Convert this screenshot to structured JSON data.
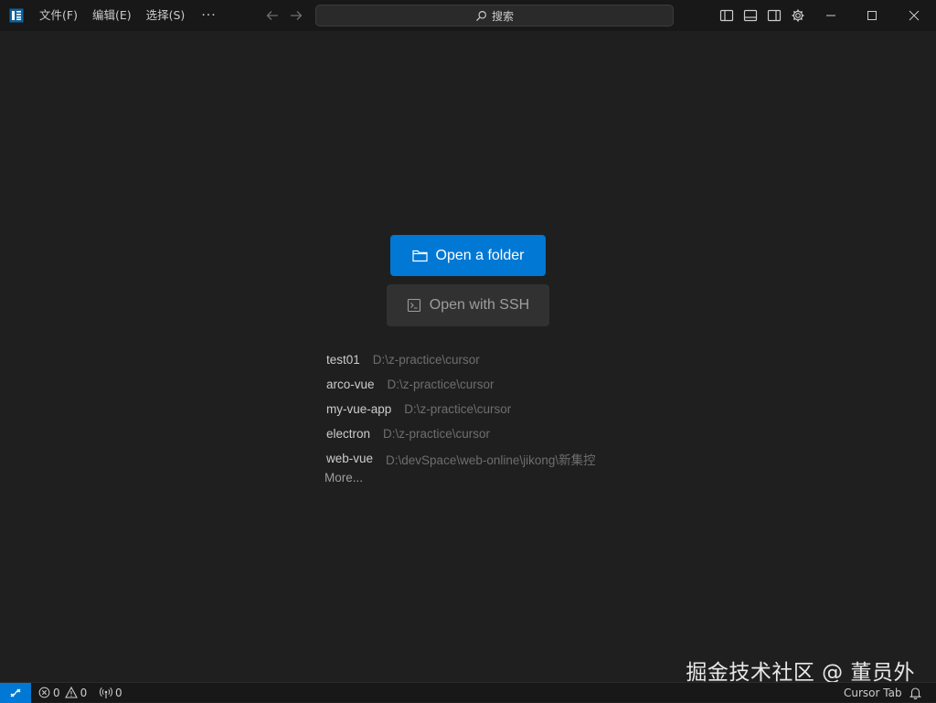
{
  "titlebar": {
    "menus": [
      "文件(F)",
      "编辑(E)",
      "选择(S)"
    ],
    "more_label": "···",
    "search": {
      "label": "搜索",
      "icon": "search-icon"
    }
  },
  "welcome": {
    "open_folder_label": "Open a folder",
    "open_ssh_label": "Open with SSH",
    "recent": [
      {
        "name": "test01",
        "path": "D:\\z-practice\\cursor"
      },
      {
        "name": "arco-vue",
        "path": "D:\\z-practice\\cursor"
      },
      {
        "name": "my-vue-app",
        "path": "D:\\z-practice\\cursor"
      },
      {
        "name": "electron",
        "path": "D:\\z-practice\\cursor"
      },
      {
        "name": "web-vue",
        "path": "D:\\devSpace\\web-online\\jikong\\新集控"
      }
    ],
    "more_label": "More..."
  },
  "watermark": "掘金技术社区 @ 董员外",
  "statusbar": {
    "errors": "0",
    "warnings": "0",
    "ports": "0",
    "cursor_tab": "Cursor Tab"
  },
  "colors": {
    "background": "#1f1f1f",
    "titlebar": "#181818",
    "accent": "#0078d4",
    "secondary_button": "#313131"
  }
}
